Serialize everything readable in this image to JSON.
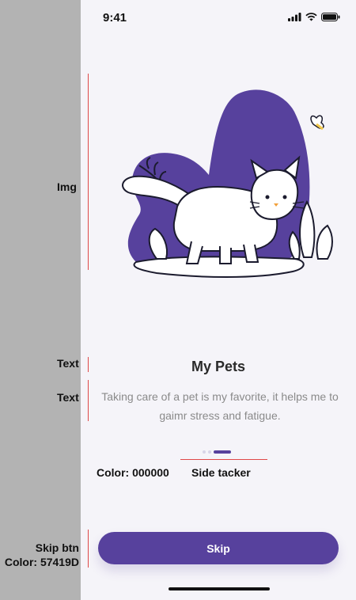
{
  "status_bar": {
    "time": "9:41"
  },
  "annotations": {
    "img": "Img",
    "text1": "Text",
    "text2": "Text",
    "skip_line1": "Skip btn",
    "skip_line2": "Color: 57419D",
    "dot_color": "Color: 000000",
    "side_tracker": "Side tacker"
  },
  "onboarding": {
    "title": "My Pets",
    "description": "Taking care of a pet is my favorite, it helps me to gaimr stress and fatigue.",
    "page_indicator": {
      "pages": 3,
      "active": 3
    },
    "skip_label": "Skip"
  },
  "colors": {
    "accent": "#57419D",
    "background": "#F5F4F9",
    "annotation_line": "#E04848"
  },
  "icons": [
    "signal-icon",
    "wifi-icon",
    "battery-icon",
    "cat-illustration"
  ]
}
